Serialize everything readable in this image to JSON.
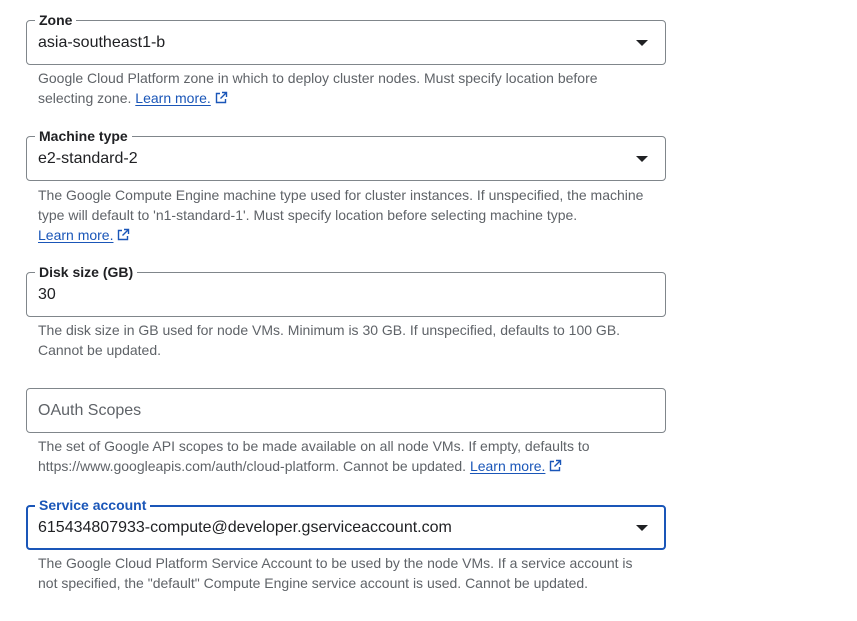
{
  "zone": {
    "label": "Zone",
    "value": "asia-southeast1-b",
    "hint": "Google Cloud Platform zone in which to deploy cluster nodes. Must specify location before selecting zone.",
    "link": "Learn more."
  },
  "machine_type": {
    "label": "Machine type",
    "value": "e2-standard-2",
    "hint": "The Google Compute Engine machine type used for cluster instances. If unspecified, the machine type will default to 'n1-standard-1'. Must specify location before selecting machine type.",
    "link": "Learn more."
  },
  "disk_size": {
    "label": "Disk size (GB)",
    "value": "30",
    "hint": "The disk size in GB used for node VMs. Minimum is 30 GB. If unspecified, defaults to 100 GB. Cannot be updated."
  },
  "oauth_scopes": {
    "placeholder": "OAuth Scopes",
    "hint": "The set of Google API scopes to be made available on all node VMs. If empty, defaults to https://www.googleapis.com/auth/cloud-platform. Cannot be updated.",
    "link": "Learn more."
  },
  "service_account": {
    "label": "Service account",
    "value": "615434807933-compute@developer.gserviceaccount.com",
    "hint": "The Google Cloud Platform Service Account to be used by the node VMs. If a service account is not specified, the \"default\" Compute Engine service account is used. Cannot be updated."
  },
  "colors": {
    "accent": "#1a56b8",
    "border": "#80868b",
    "hint_text": "#5f6368"
  }
}
